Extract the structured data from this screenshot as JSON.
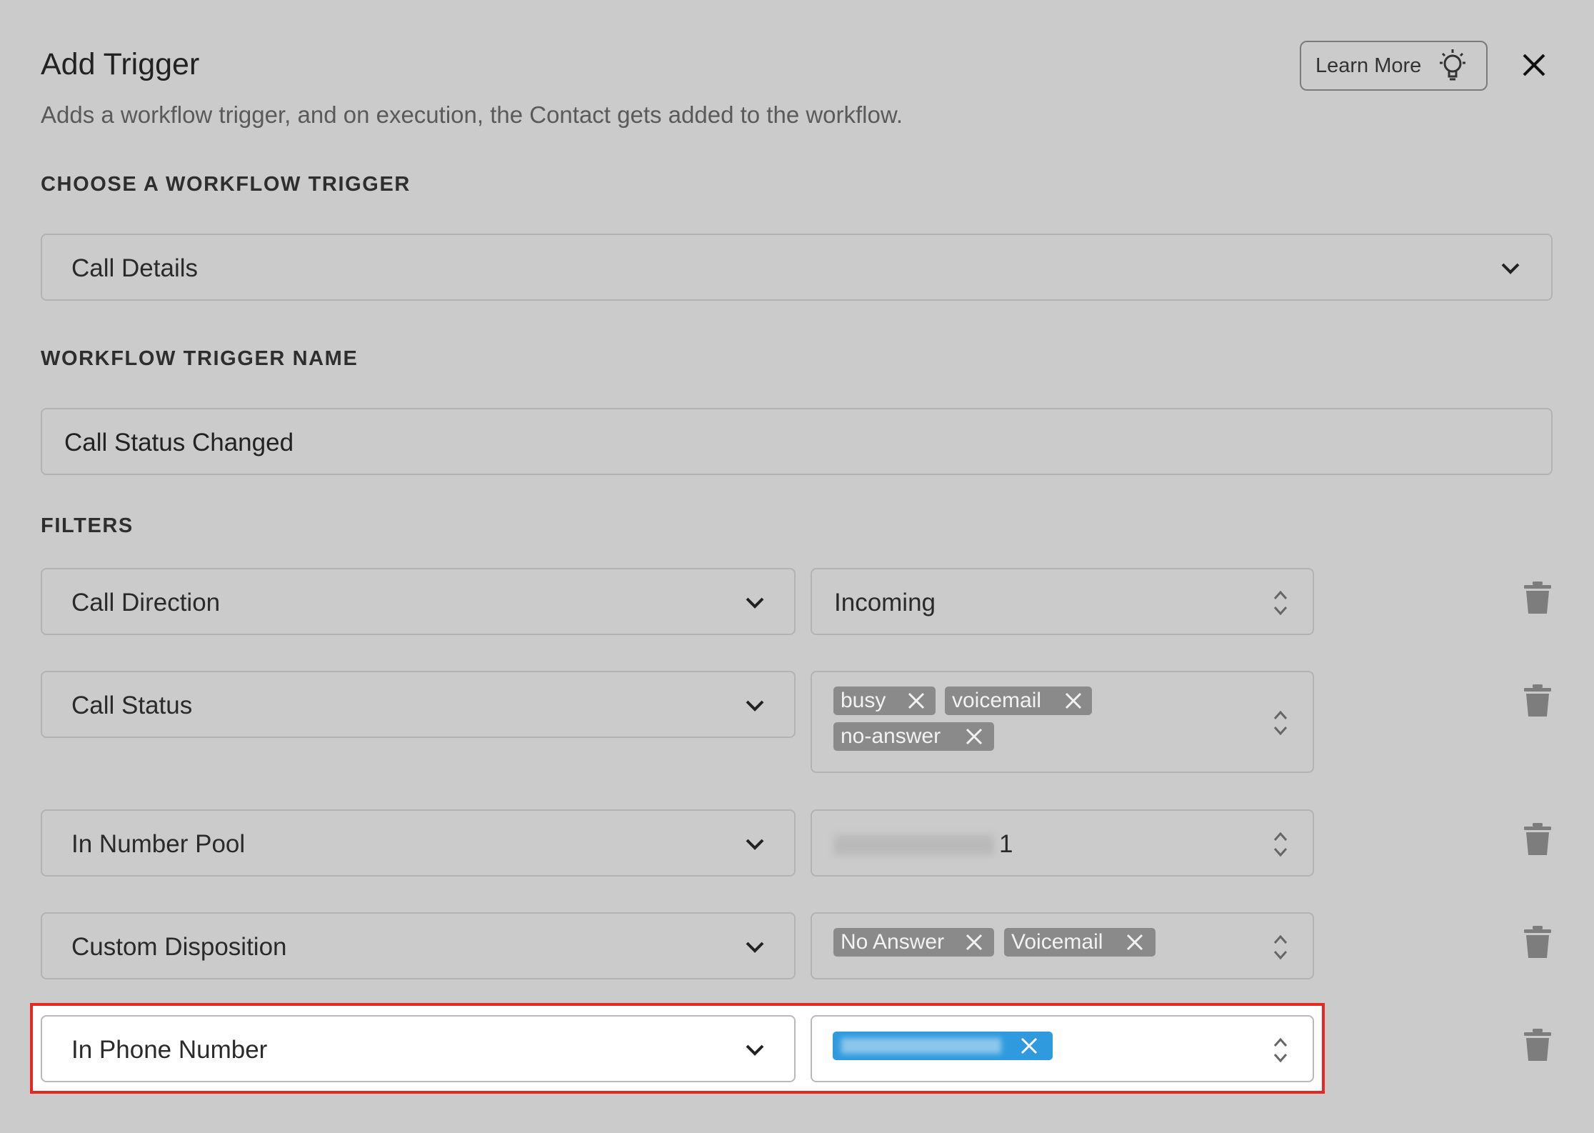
{
  "modal": {
    "title": "Add Trigger",
    "subtitle": "Adds a workflow trigger, and on execution, the Contact gets added to the workflow.",
    "learn_more_label": "Learn More"
  },
  "trigger": {
    "section_label": "CHOOSE A WORKFLOW TRIGGER",
    "selected": "Call Details"
  },
  "trigger_name": {
    "section_label": "WORKFLOW TRIGGER NAME",
    "value": "Call Status Changed"
  },
  "filters": {
    "section_label": "FILTERS",
    "rows": [
      {
        "field": "Call Direction",
        "value": "Incoming",
        "tags": []
      },
      {
        "field": "Call Status",
        "value": "",
        "tags": [
          "busy",
          "voicemail",
          "no-answer"
        ]
      },
      {
        "field": "In Number Pool",
        "value_visible_suffix": "1",
        "tags": []
      },
      {
        "field": "Custom Disposition",
        "value": "",
        "tags": [
          "No Answer",
          "Voicemail"
        ]
      },
      {
        "field": "In Phone Number",
        "value": "",
        "tags": []
      }
    ]
  },
  "colors": {
    "background": "#cbcbcb",
    "highlight_border": "#e8281f",
    "selected_tag": "#2f9bde",
    "tag_gray": "#8a8a8a"
  },
  "icons": {
    "learn_more": "lightbulb-icon",
    "close": "close-icon",
    "dropdown": "chevron-down-icon",
    "select": "updown-chevron-icon",
    "delete": "trash-icon",
    "tag_remove": "x-icon"
  }
}
